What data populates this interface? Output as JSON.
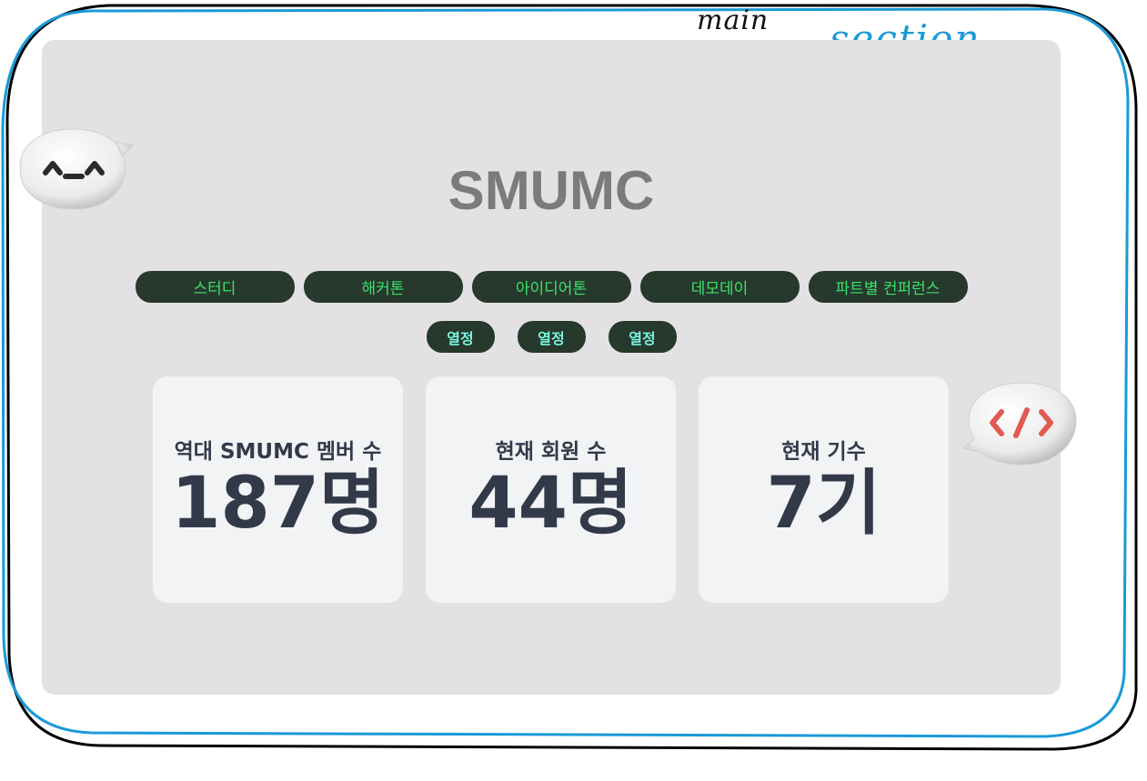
{
  "annotations": {
    "main_label": "main",
    "section_label": "section"
  },
  "section": {
    "title": "SMUMC",
    "activities": [
      "스터디",
      "해커톤",
      "아이디어톤",
      "데모데이",
      "파트별 컨퍼런스"
    ],
    "passion_tags": [
      "열정",
      "열정",
      "열정"
    ],
    "stats": [
      {
        "label": "역대 SMUMC 멤버 수",
        "value": "187명"
      },
      {
        "label": "현재 회원 수",
        "value": "44명"
      },
      {
        "label": "현재 기수",
        "value": "7기"
      }
    ]
  },
  "colors": {
    "section_bg": "#e3e1e3",
    "title": "#7b7b7b",
    "pill_bg": "#27382d",
    "pill_text": "#39e36a",
    "tag_text": "#7af6df",
    "card_bg": "#f2f3f5",
    "card_text": "#323a4a",
    "outline_blue": "#1a9ad6"
  },
  "icons": {
    "left_bubble": "smiley-emoticon-bubble-icon",
    "right_bubble": "code-tag-bubble-icon"
  }
}
